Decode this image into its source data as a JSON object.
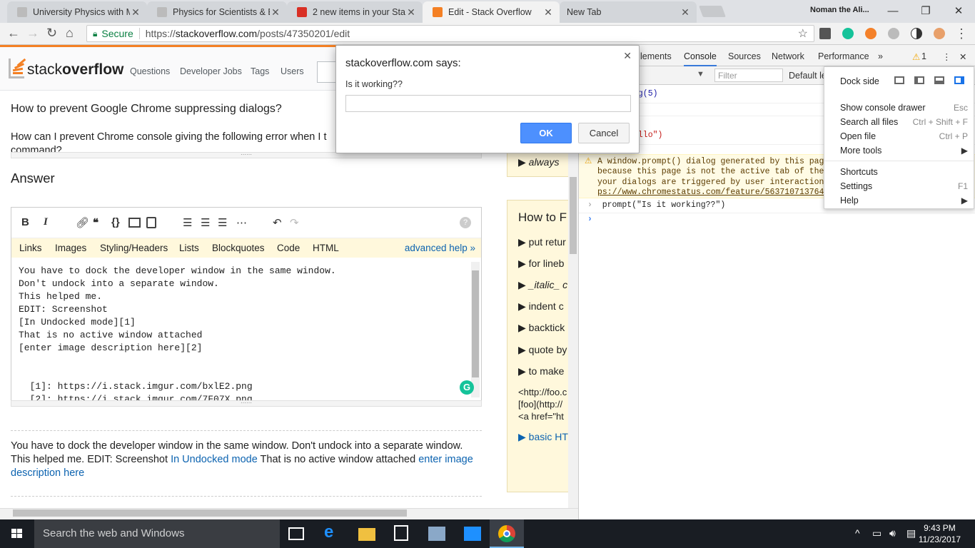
{
  "browser": {
    "tabs": [
      {
        "title": "University Physics with M",
        "active": false
      },
      {
        "title": "Physics for Scientists & E",
        "active": false
      },
      {
        "title": "2 new items in your Stac",
        "active": false
      },
      {
        "title": "Edit - Stack Overflow",
        "active": true
      },
      {
        "title": "New Tab",
        "active": false
      }
    ],
    "profile_name": "Noman the Ali...",
    "secure_label": "Secure",
    "url_scheme": "https://",
    "url_host": "stackoverflow.com",
    "url_path": "/posts/47350201/edit"
  },
  "so": {
    "logo_light": "stack",
    "logo_bold": "overflow",
    "nav": [
      "Questions",
      "Developer Jobs",
      "Tags",
      "Users"
    ],
    "question_title": "How to prevent Google Chrome suppressing dialogs?",
    "question_body": "How can I prevent Chrome console giving the following error when I t",
    "question_body2": "command?",
    "answer_heading": "Answer",
    "help_tabs": [
      "Links",
      "Images",
      "Styling/Headers",
      "Lists",
      "Blockquotes",
      "Code",
      "HTML"
    ],
    "advanced_help": "advanced help »",
    "textarea_value": "You have to dock the developer window in the same window.\nDon't undock into a separate window.\nThis helped me.\nEDIT: Screenshot\n[In Undocked mode][1]\nThat is no active window attached\n[enter image description here][2]\n\n\n  [1]: https://i.stack.imgur.com/bxlE2.png\n  [2]: https://i.stack.imgur.com/7F07X.png",
    "preview_text1": "You have to dock the developer window in the same window. Don't undock into a separate window. This helped me. EDIT: Screenshot ",
    "preview_link1": "In Undocked mode",
    "preview_text2": " That is no active window attached ",
    "preview_link2": "enter image description here",
    "sidebar_top": "always",
    "sidebar_title": "How to F",
    "sidebar_items": [
      "put retur",
      "for lineb",
      "_italic_ c",
      "indent c",
      "backtick",
      "quote by",
      "to make"
    ],
    "sidebar_code": [
      "<http://foo.c",
      "[foo](http://",
      "<a href=\"ht"
    ],
    "sidebar_basic": "basic HT"
  },
  "dialog": {
    "title": "stackoverflow.com says:",
    "message": "Is it working??",
    "ok": "OK",
    "cancel": "Cancel"
  },
  "devtools": {
    "tabs": [
      "lements",
      "Console",
      "Sources",
      "Network",
      "Performance"
    ],
    "warning_count": "1",
    "filter_placeholder": "Filter",
    "default_levels": "Default le",
    "console_lines": [
      "og(5)",
      "ello\")"
    ],
    "warning_lines": [
      "A window.prompt() dialog generated by this page",
      "because this page is not the active tab of the f",
      "your dialogs are triggered by user interactions"
    ],
    "warning_link": "ps://www.chromestatus.com/feature/56371071376424",
    "prompt_line": "prompt(\"Is it working??\")",
    "menu": {
      "dock_side": "Dock side",
      "items": [
        {
          "label": "Show console drawer",
          "key": "Esc"
        },
        {
          "label": "Search all files",
          "key": "Ctrl + Shift + F"
        },
        {
          "label": "Open file",
          "key": "Ctrl + P"
        },
        {
          "label": "More tools",
          "key": "▶"
        },
        {
          "label": "Shortcuts",
          "key": ""
        },
        {
          "label": "Settings",
          "key": "F1"
        },
        {
          "label": "Help",
          "key": "▶"
        }
      ]
    }
  },
  "taskbar": {
    "search_placeholder": "Search the web and Windows",
    "time": "9:43 PM",
    "date": "11/23/2017"
  }
}
